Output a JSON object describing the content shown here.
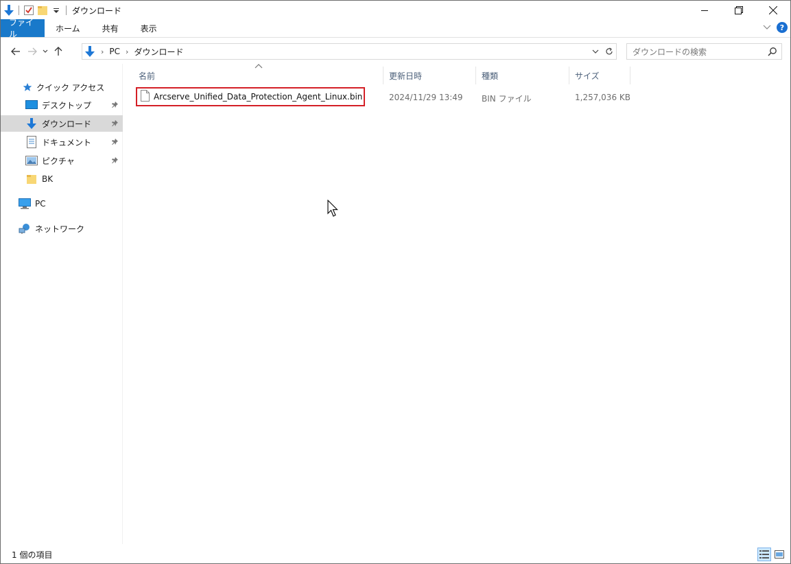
{
  "window": {
    "title": "ダウンロード"
  },
  "ribbon": {
    "tabs": [
      "ファイル",
      "ホーム",
      "共有",
      "表示"
    ]
  },
  "address": {
    "crumbs": [
      "PC",
      "ダウンロード"
    ]
  },
  "search": {
    "placeholder": "ダウンロードの検索"
  },
  "sidebar": {
    "quick_access": "クイック アクセス",
    "items": [
      "デスクトップ",
      "ダウンロード",
      "ドキュメント",
      "ピクチャ",
      "BK"
    ],
    "pc": "PC",
    "network": "ネットワーク"
  },
  "columns": {
    "name": "名前",
    "modified": "更新日時",
    "type": "種類",
    "size": "サイズ"
  },
  "files": [
    {
      "name": "Arcserve_Unified_Data_Protection_Agent_Linux.bin",
      "modified": "2024/11/29 13:49",
      "type": "BIN ファイル",
      "size": "1,257,036 KB"
    }
  ],
  "status": {
    "count": "1 個の項目"
  },
  "colors": {
    "accent": "#1979ca",
    "highlight": "#d41f26",
    "selected": "#d9d9d9"
  }
}
